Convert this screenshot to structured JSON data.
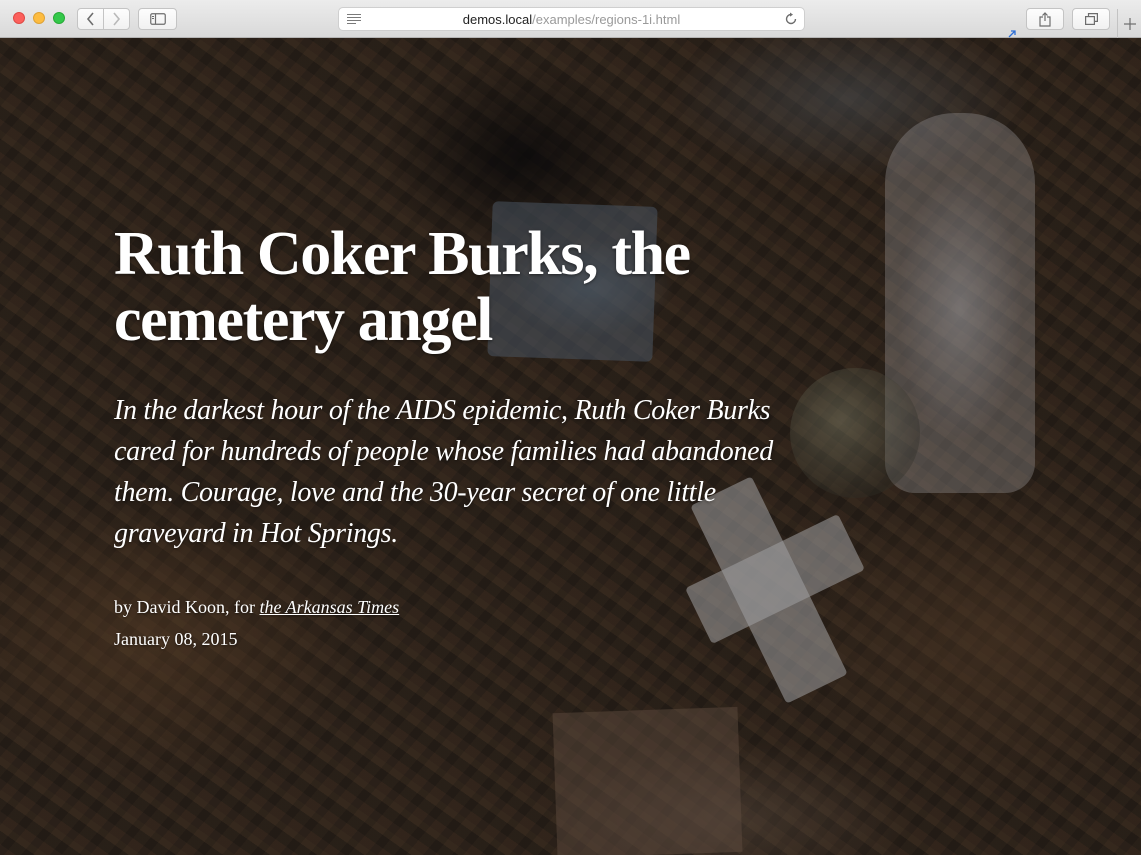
{
  "browser": {
    "url_host": "demos.local",
    "url_path": "/examples/regions-1i.html"
  },
  "article": {
    "headline": "Ruth Coker Burks, the cemetery angel",
    "dek": "In the darkest hour of the AIDS epidemic, Ruth Coker Burks cared for hundreds of people whose families had abandoned them. Courage, love and the 30-year secret of one little graveyard in Hot Springs.",
    "byline_prefix": "by David Koon, for",
    "publication": "the Arkansas Times",
    "date": "January 08, 2015"
  },
  "icons": {
    "back": "chevron-left-icon",
    "forward": "chevron-right-icon",
    "sidebar": "sidebar-icon",
    "reader": "reader-icon",
    "reload": "reload-icon",
    "share": "share-icon",
    "tabs": "tabs-icon",
    "new_tab": "plus-icon"
  }
}
